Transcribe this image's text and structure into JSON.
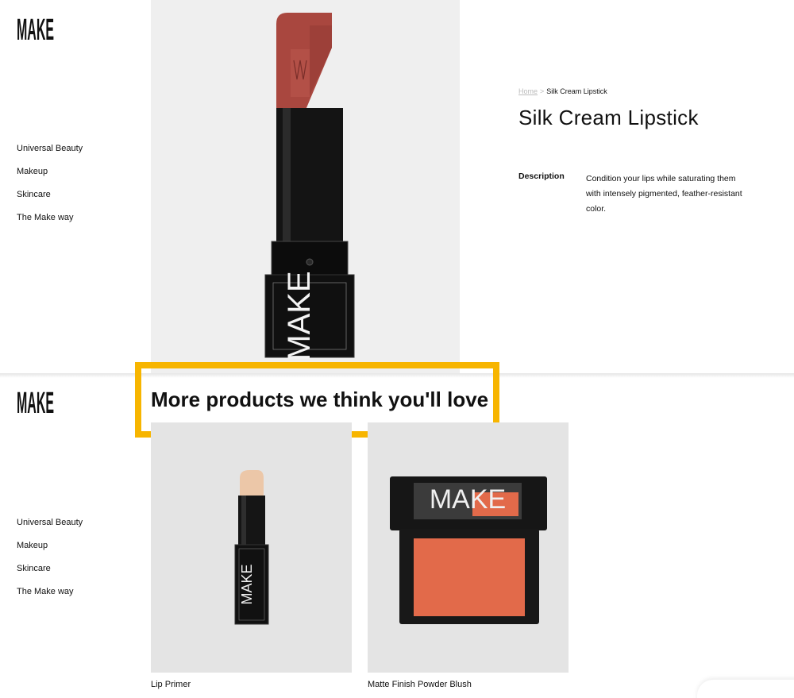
{
  "brand": {
    "logo_text": "MAKE"
  },
  "nav": {
    "items": [
      {
        "label": "Universal Beauty"
      },
      {
        "label": "Makeup"
      },
      {
        "label": "Skincare"
      },
      {
        "label": "The Make way"
      }
    ]
  },
  "breadcrumb": {
    "home": "Home",
    "separator": ">",
    "current": "Silk Cream Lipstick"
  },
  "product": {
    "title": "Silk Cream Lipstick",
    "description_label": "Description",
    "description_text": "Condition your lips while saturating them with intensely pigmented, feather-resistant color.",
    "image_text": "MAKE"
  },
  "recommendations": {
    "heading": "More products we think you'll love",
    "items": [
      {
        "name": "Lip Primer",
        "image_text": "MAKE"
      },
      {
        "name": "Matte Finish Powder Blush",
        "image_text": "MAKE"
      }
    ]
  },
  "colors": {
    "highlight": "#f7b500",
    "lipstick": "#a9473f",
    "blush": "#e26a4a",
    "panel": "#efefef"
  }
}
